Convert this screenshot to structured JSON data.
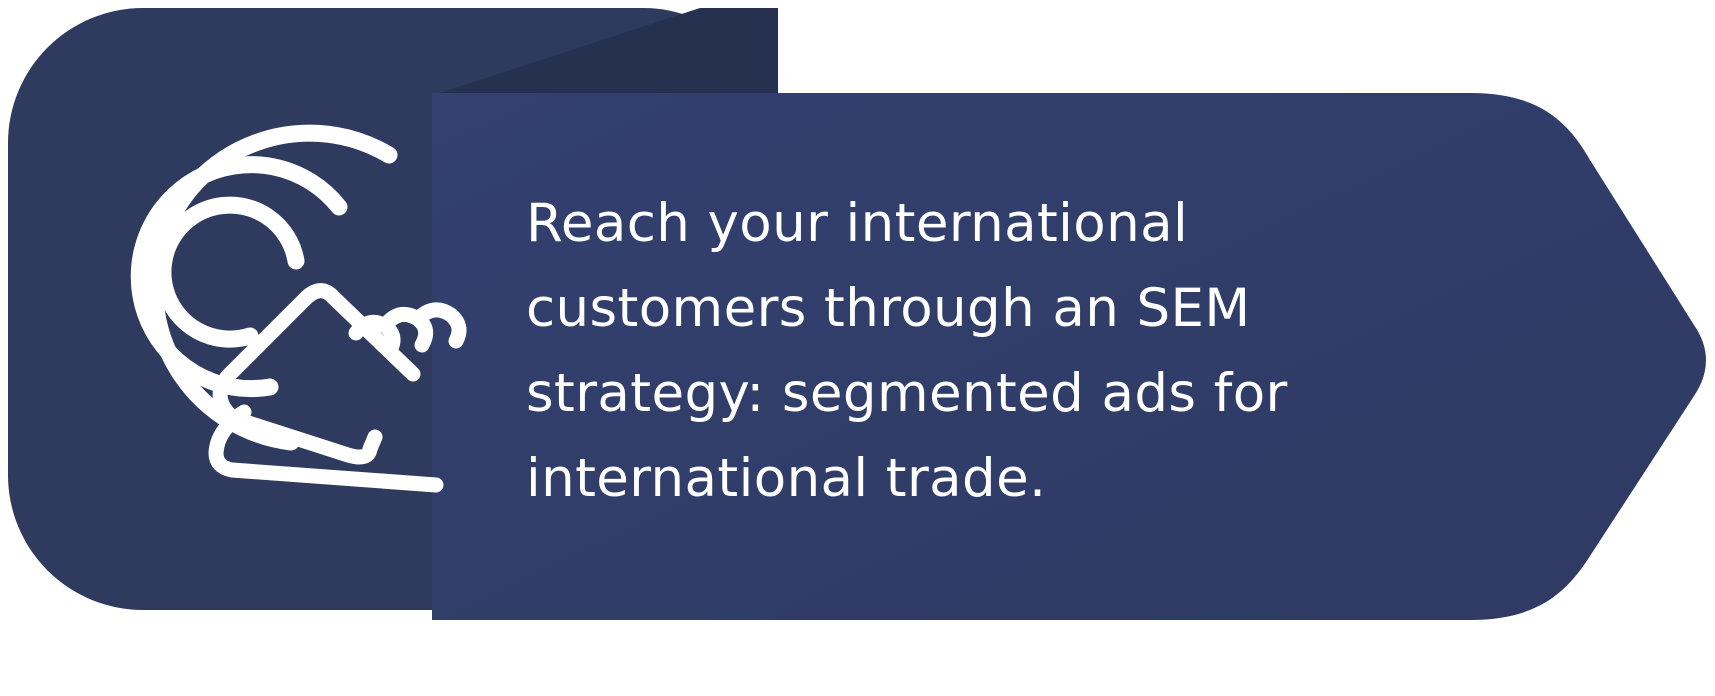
{
  "message": "Reach your international\ncustomers through an SEM\nstrategy: segmented ads for\ninternational trade.",
  "icon": "touch-target-icon",
  "colors": {
    "background": "#ffffff",
    "card": "#2e3a5e",
    "card_dark": "#26314f",
    "arrow_panel": "#303c63",
    "text": "#ffffff",
    "icon": "#ffffff"
  }
}
